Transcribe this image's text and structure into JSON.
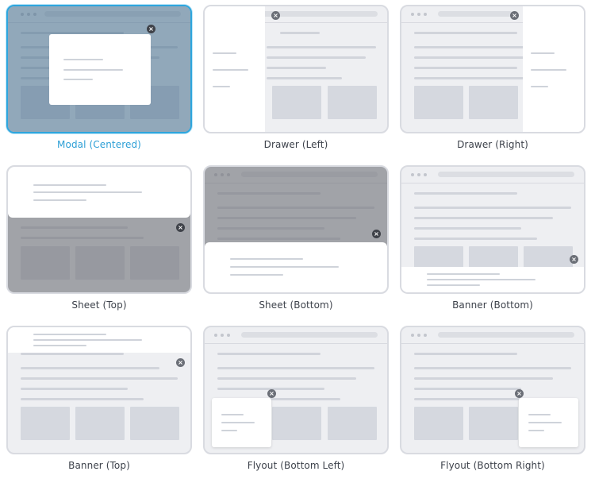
{
  "colors": {
    "selected": "#2ea6de",
    "border": "#d9dbe1",
    "surface": "#eeeff2"
  },
  "icons": {
    "close": "close-icon"
  },
  "close_glyph": "×",
  "selected_option": "Modal (Centered)",
  "options": [
    {
      "id": "modal-centered",
      "label": "Modal (Centered)"
    },
    {
      "id": "drawer-left",
      "label": "Drawer (Left)"
    },
    {
      "id": "drawer-right",
      "label": "Drawer (Right)"
    },
    {
      "id": "sheet-top",
      "label": "Sheet (Top)"
    },
    {
      "id": "sheet-bottom",
      "label": "Sheet (Bottom)"
    },
    {
      "id": "banner-bottom",
      "label": "Banner (Bottom)"
    },
    {
      "id": "banner-top",
      "label": "Banner (Top)"
    },
    {
      "id": "flyout-bottom-left",
      "label": "Flyout (Bottom Left)"
    },
    {
      "id": "flyout-bottom-right",
      "label": "Flyout (Bottom Right)"
    }
  ]
}
